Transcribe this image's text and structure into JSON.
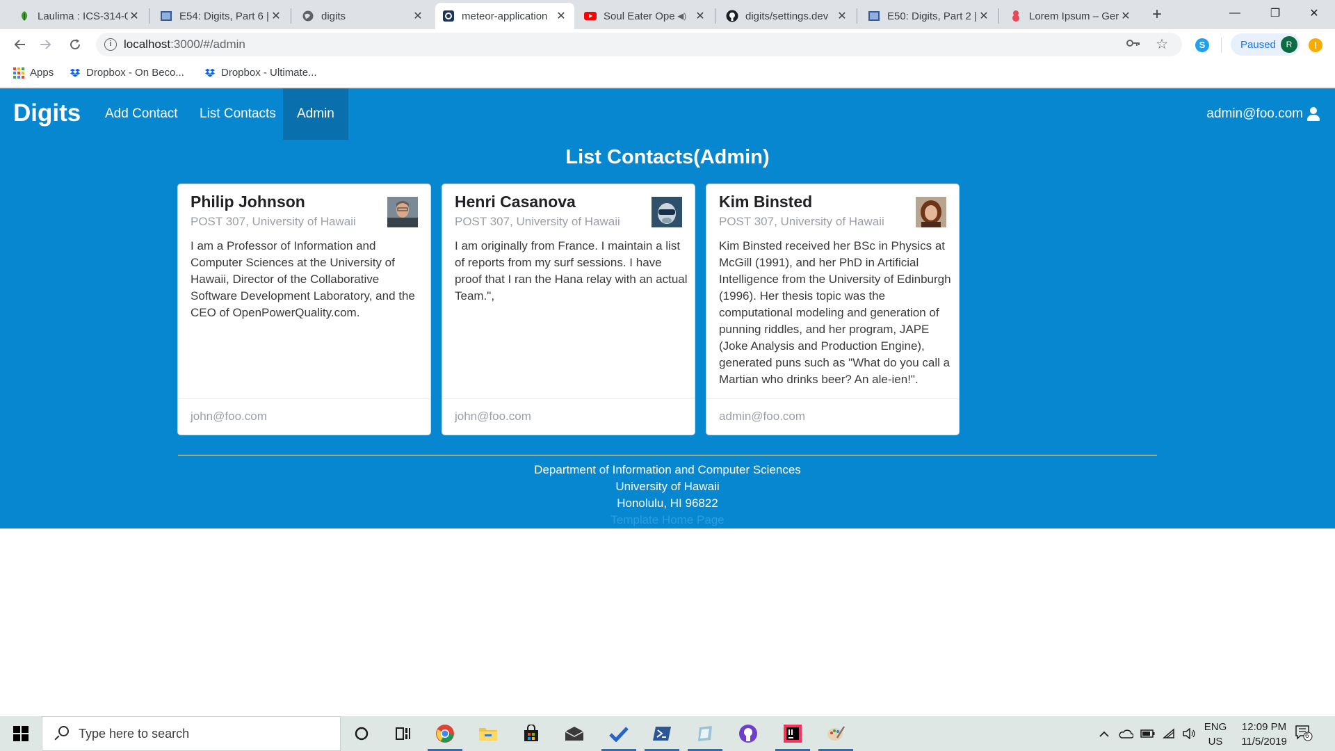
{
  "browser": {
    "tabs": [
      {
        "title": "Laulima : ICS-314-0",
        "icon": "laulima-icon"
      },
      {
        "title": "E54: Digits, Part 6 | ",
        "icon": "course-page-icon"
      },
      {
        "title": "digits",
        "icon": "globe-icon"
      },
      {
        "title": "meteor-application",
        "icon": "meteor-app-icon",
        "active": true
      },
      {
        "title": "Soul Eater Ope",
        "icon": "youtube-icon",
        "audio": true
      },
      {
        "title": "digits/settings.dev",
        "icon": "github-icon"
      },
      {
        "title": "E50: Digits, Part 2 | ",
        "icon": "course-page-icon"
      },
      {
        "title": "Lorem Ipsum – Ger",
        "icon": "lorem-ipsum-icon"
      }
    ],
    "close_glyph": "✕",
    "new_tab_glyph": "+",
    "window_controls": {
      "minimize": "—",
      "maximize": "❐",
      "close": "✕"
    },
    "address": {
      "host": "localhost",
      "path": ":3000/#/admin"
    },
    "profile": {
      "status": "Paused",
      "initial": "R"
    },
    "update_badge": "!",
    "skype_glyph": "S",
    "bookmarks": [
      {
        "label": "Apps",
        "icon": "apps-grid-icon"
      },
      {
        "label": "Dropbox - On Beco...",
        "icon": "dropbox-icon"
      },
      {
        "label": "Dropbox - Ultimate...",
        "icon": "dropbox-icon"
      }
    ]
  },
  "app": {
    "brand": "Digits",
    "nav": [
      {
        "label": "Add Contact"
      },
      {
        "label": "List Contacts"
      },
      {
        "label": "Admin",
        "active": true
      }
    ],
    "user": "admin@foo.com",
    "page_title": "List Contacts(Admin)",
    "contacts": [
      {
        "name": "Philip Johnson",
        "address": "POST 307, University of Hawaii",
        "description": "I am a Professor of Information and Computer Sciences at the University of Hawaii, Director of the Collaborative Software Development Laboratory, and the CEO of OpenPowerQuality.com.",
        "owner": "john@foo.com"
      },
      {
        "name": "Henri Casanova",
        "address": "POST 307, University of Hawaii",
        "description": "I am originally from France. I maintain a list of reports from my surf sessions. I have proof that I ran the Hana relay with an actual Team.\",",
        "owner": "john@foo.com"
      },
      {
        "name": "Kim Binsted",
        "address": "POST 307, University of Hawaii",
        "description": "Kim Binsted received her BSc in Physics at McGill (1991), and her PhD in Artificial Intelligence from the University of Edinburgh (1996). Her thesis topic was the computational modeling and generation of punning riddles, and her program, JAPE (Joke Analysis and Production Engine), generated puns such as \"What do you call a Martian who drinks beer? An ale-ien!\".",
        "owner": "admin@foo.com"
      }
    ],
    "footer": {
      "line1": "Department of Information and Computer Sciences",
      "line2": "University of Hawaii",
      "line3": "Honolulu, HI 96822",
      "line4": "Template Home Page"
    }
  },
  "taskbar": {
    "search_placeholder": "Type here to search",
    "pinned": [
      "cortana-icon",
      "task-view-icon",
      "chrome-icon",
      "file-explorer-icon",
      "store-icon",
      "mail-icon",
      "todo-icon",
      "powershell-icon",
      "app-icon",
      "github-desktop-icon",
      "intellij-icon",
      "paint-icon"
    ],
    "language": {
      "line1": "ENG",
      "line2": "US"
    },
    "time": "12:09 PM",
    "date": "11/5/2019",
    "notification_count": "6"
  }
}
